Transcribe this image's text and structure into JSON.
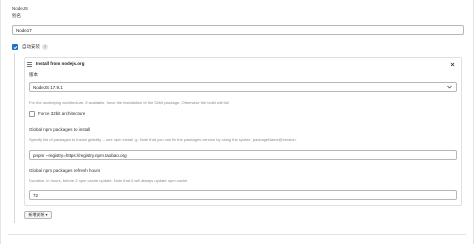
{
  "header": {
    "title": "NodeJS",
    "subtitle": "别名"
  },
  "name_field": {
    "value": "Node17"
  },
  "auto_install": {
    "checked": true,
    "label": "自动安装",
    "help": "?"
  },
  "installer": {
    "title": "Install from nodejs.org",
    "version_label": "版本",
    "version_value": "NodeJS 17.9.1",
    "arch_note": "For the underlying architecture, if available, force the installation of the 32bit package. Otherwise the build will fail",
    "force32_label": "Force 32bit architecture",
    "force32_checked": false,
    "global_packages_label": "Global npm packages to install",
    "global_packages_help": "Specify list of packages to install globally -- see npm install -g. Note that you can fix the packages version by using the syntax `packageName@version`",
    "global_packages_value": "pnpm --registry=https://registry.npm.taobao.org",
    "refresh_label": "Global npm packages refresh hours",
    "refresh_help": "Duration, in hours, before 2 npm cache update. Note that 0 will always update npm cache",
    "refresh_value": "72"
  },
  "add_installer": {
    "label": "新增安装 ▾"
  }
}
